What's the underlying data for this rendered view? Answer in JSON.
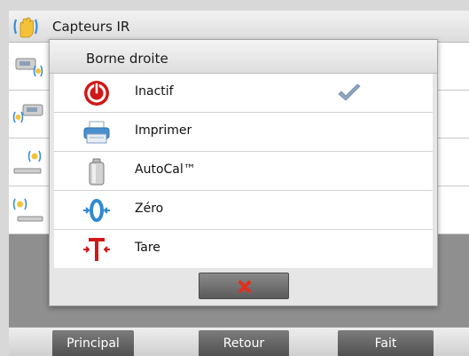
{
  "screen": {
    "title": "Capteurs IR",
    "bottom_nav": {
      "principal": "Principal",
      "retour": "Retour",
      "fait": "Fait"
    }
  },
  "dialog": {
    "title": "Borne droite",
    "options": [
      {
        "label": "Inactif",
        "icon": "power-off-icon",
        "selected": true
      },
      {
        "label": "Imprimer",
        "icon": "printer-icon",
        "selected": false
      },
      {
        "label": "AutoCal™",
        "icon": "calibration-weight-icon",
        "selected": false
      },
      {
        "label": "Zéro",
        "icon": "zero-icon",
        "selected": false
      },
      {
        "label": "Tare",
        "icon": "tare-icon",
        "selected": false
      }
    ],
    "cancel_icon": "close-icon"
  },
  "colors": {
    "accent_red": "#d01818",
    "accent_blue": "#2e8ad0",
    "check_blue": "#8fa6c2"
  }
}
